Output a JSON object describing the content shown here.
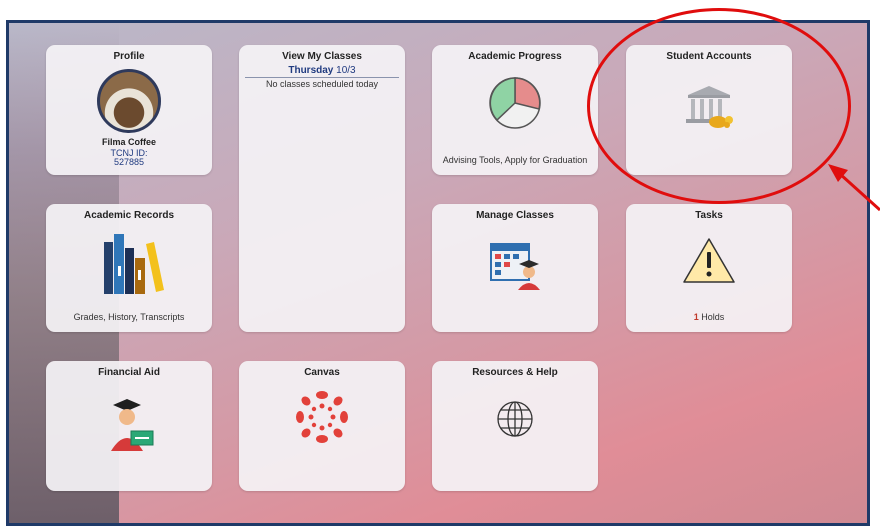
{
  "tiles": {
    "profile": {
      "title": "Profile",
      "name": "Filma Coffee",
      "id_label": "TCNJ ID:",
      "id_value": "527885"
    },
    "classes": {
      "title": "View My Classes",
      "day": "Thursday",
      "date": "10/3",
      "message": "No classes scheduled today"
    },
    "progress": {
      "title": "Academic Progress",
      "footer": "Advising Tools, Apply for Graduation"
    },
    "accounts": {
      "title": "Student Accounts"
    },
    "records": {
      "title": "Academic Records",
      "footer": "Grades, History, Transcripts"
    },
    "manage": {
      "title": "Manage Classes"
    },
    "tasks": {
      "title": "Tasks",
      "count": "1",
      "label": "Holds"
    },
    "aid": {
      "title": "Financial Aid"
    },
    "canvas": {
      "title": "Canvas"
    },
    "resources": {
      "title": "Resources & Help"
    }
  },
  "icons": {
    "profile": "avatar-photo",
    "progress": "pie-chart-icon",
    "accounts": "bank-coins-icon",
    "records": "books-icon",
    "manage": "calendar-student-icon",
    "tasks": "warning-icon",
    "aid": "graduate-money-icon",
    "canvas": "canvas-logo-icon",
    "resources": "globe-icon"
  },
  "colors": {
    "accent": "#203b80",
    "annotation": "#e00d0d",
    "alert": "#c0392b"
  }
}
